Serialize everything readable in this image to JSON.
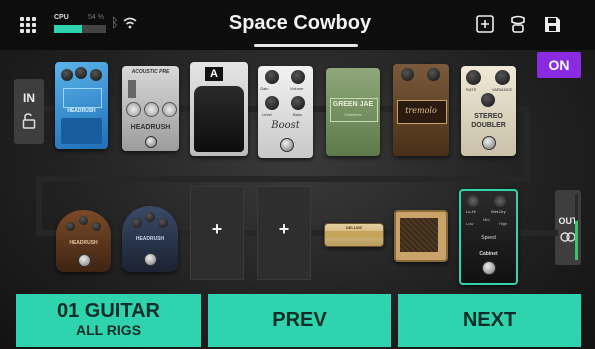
{
  "header": {
    "cpu_label": "CPU",
    "cpu_percent": "54 %",
    "cpu_level": 0.54,
    "preset_name": "Space Cowboy"
  },
  "in_label": "IN",
  "out_label": "OUT",
  "on_badge": "ON",
  "pedal_labels": {
    "headrush_blue": "HEADRUSH",
    "acoustic_sub": "ACOUSTIC PRE",
    "acoustic_name": "HEADRUSH",
    "wah_letter": "A",
    "boost_knob1": "Gain",
    "boost_knob2": "Volume",
    "boost_knob3": "Level",
    "boost_knob4": "Bass",
    "boost_name": "Boost",
    "green_name": "GREEN JAE",
    "green_sub": "Overdrive",
    "tremolo_name": "tremolo",
    "doubler_k1": "RATE",
    "doubler_k2": "VARIANCE",
    "doubler_name1": "STEREO",
    "doubler_name2": "DOUBLER",
    "fuzz1_name": "HEADRUSH",
    "fuzz2_name": "HEADRUSH",
    "amp1_name": "DELUXE",
    "comp_k1": "Lo-Hi",
    "comp_k2": "Wet-Dry",
    "comp_k3": "Low",
    "comp_k4": "Mid",
    "comp_k5": "High",
    "comp_k6": "Speed",
    "comp_name": "Cabinet"
  },
  "empty_slot_symbol": "+",
  "bottom_buttons": {
    "rig_number": "01 GUITAR",
    "rig_sub": "ALL RIGS",
    "prev": "PREV",
    "next": "NEXT"
  },
  "colors": {
    "accent": "#2fd3ad",
    "on_badge": "#8a2be2",
    "selected_border": "#2fd3ad"
  }
}
